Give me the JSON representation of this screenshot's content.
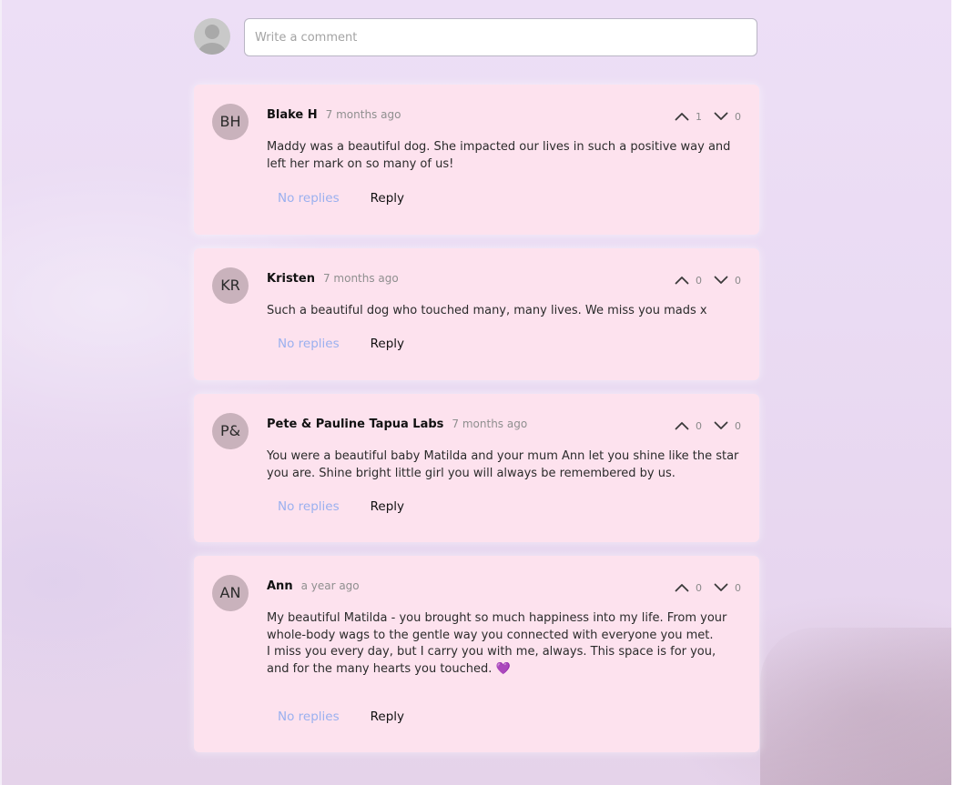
{
  "composer": {
    "placeholder": "Write a comment"
  },
  "comments": [
    {
      "initials": "BH",
      "author": "Blake H",
      "time": "7 months ago",
      "upvotes": "1",
      "downvotes": "0",
      "body": [
        "Maddy was a beautiful dog. She impacted our lives in such a positive way and left her mark on so many of us!"
      ],
      "replies_label": "No replies",
      "reply_label": "Reply"
    },
    {
      "initials": "KR",
      "author": "Kristen",
      "time": "7 months ago",
      "upvotes": "0",
      "downvotes": "0",
      "body": [
        "Such a beautiful dog who touched many, many lives. We miss you mads x"
      ],
      "replies_label": "No replies",
      "reply_label": "Reply"
    },
    {
      "initials": "P&",
      "author": "Pete & Pauline Tapua Labs",
      "time": "7 months ago",
      "upvotes": "0",
      "downvotes": "0",
      "body": [
        "You were a beautiful baby Matilda and your mum Ann let you shine like the star you are. Shine bright little girl you will always be remembered by us."
      ],
      "replies_label": "No replies",
      "reply_label": "Reply"
    },
    {
      "initials": "AN",
      "author": "Ann",
      "time": "a year ago",
      "upvotes": "0",
      "downvotes": "0",
      "body": [
        "My beautiful Matilda - you brought so much happiness into my life. From your whole-body wags to the gentle way you connected with everyone you met.",
        "I miss you every day, but I carry you with me, always. This space is for you, and for the many hearts you touched. 💜"
      ],
      "replies_label": "No replies",
      "reply_label": "Reply"
    }
  ],
  "colors": {
    "card_bg": "#fde2ee",
    "avatar_bg": "#c9b2bc",
    "link_blue": "#9ab0ef",
    "page_bg": "#eddff6"
  },
  "icons": {
    "upvote": "chevron-up-icon",
    "downvote": "chevron-down-icon",
    "user": "user-placeholder-icon"
  }
}
